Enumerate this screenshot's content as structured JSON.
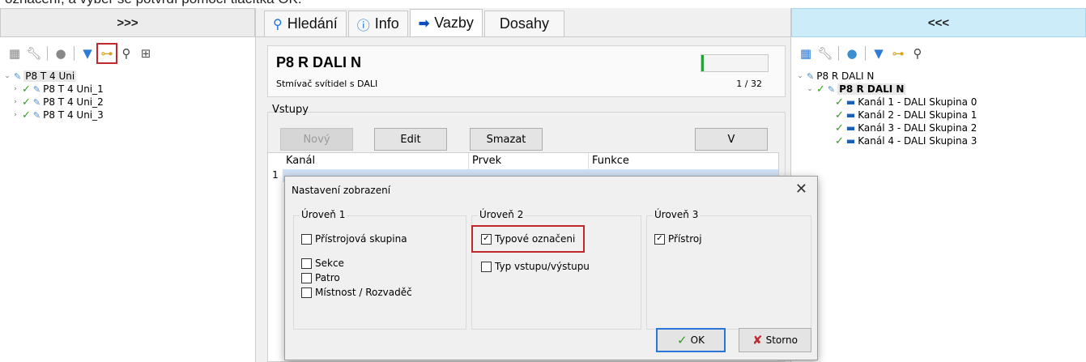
{
  "top_caption": "označení, a výběr se potvrdí pomocí tlačítka OK.",
  "left_panel": {
    "header": ">>>",
    "toolbar_icons": [
      "list-icon",
      "wrench-icon",
      "globe-icon",
      "filter-icon",
      "tree-view-icon",
      "search-icon",
      "expand-collapse-icon"
    ],
    "tree": [
      {
        "label": "P8 T 4 Uni",
        "level": 0,
        "expanded": true,
        "checked": false
      },
      {
        "label": "P8 T 4 Uni_1",
        "level": 1,
        "expanded": false,
        "checked": true
      },
      {
        "label": "P8 T 4 Uni_2",
        "level": 1,
        "expanded": false,
        "checked": true
      },
      {
        "label": "P8 T 4 Uni_3",
        "level": 1,
        "expanded": false,
        "checked": true
      }
    ]
  },
  "center_panel": {
    "tabs": [
      {
        "label": "Hledání",
        "icon": "search-icon"
      },
      {
        "label": "Info",
        "icon": "info-icon"
      },
      {
        "label": "Vazby",
        "icon": "arrow-right-icon",
        "active": true
      },
      {
        "label": "Dosahy",
        "icon": ""
      }
    ],
    "device": {
      "title": "P8 R DALI N",
      "subtitle": "Stmívač svítidel s DALI",
      "count": "1 / 32",
      "progress_fraction": 0.03
    },
    "inputs_group_label": "Vstupy",
    "buttons": {
      "new": "Nový",
      "edit": "Edit",
      "delete": "Smazat",
      "v": "V"
    },
    "grid": {
      "columns": [
        "Kanál",
        "Prvek",
        "Funkce"
      ],
      "row_numbers": [
        "1"
      ]
    }
  },
  "right_panel": {
    "header": "<<<",
    "toolbar_icons": [
      "list-icon",
      "wrench-icon",
      "globe-icon",
      "filter-icon",
      "tree-view-icon",
      "search-icon"
    ],
    "tree": [
      {
        "label": "P8 R DALI N",
        "level": 0
      },
      {
        "label": "P8 R DALI N",
        "level": 1,
        "selected": true
      },
      {
        "label": "Kanál 1 - DALI Skupina 0",
        "level": 2
      },
      {
        "label": "Kanál 2 - DALI Skupina 1",
        "level": 2
      },
      {
        "label": "Kanál 3 - DALI Skupina 2",
        "level": 2
      },
      {
        "label": "Kanál 4 - DALI Skupina 3",
        "level": 2
      }
    ]
  },
  "dialog": {
    "title": "Nastavení zobrazení",
    "level1": {
      "label": "Úroveň 1",
      "options": [
        {
          "label": "Přístrojová skupina",
          "checked": false
        },
        {
          "label": "Sekce",
          "checked": false
        },
        {
          "label": "Patro",
          "checked": false
        },
        {
          "label": "Místnost / Rozvaděč",
          "checked": false
        }
      ]
    },
    "level2": {
      "label": "Úroveň 2",
      "options": [
        {
          "label": "Typové označeni",
          "checked": true
        },
        {
          "label": "Typ vstupu/výstupu",
          "checked": false
        }
      ]
    },
    "level3": {
      "label": "Úroveň 3",
      "options": [
        {
          "label": "Přístroj",
          "checked": true
        }
      ]
    },
    "ok_label": "OK",
    "cancel_label": "Storno"
  },
  "colors": {
    "highlight_red": "#c0282d",
    "check_green": "#2e9e1e",
    "right_header_bg": "#ccecfa"
  }
}
